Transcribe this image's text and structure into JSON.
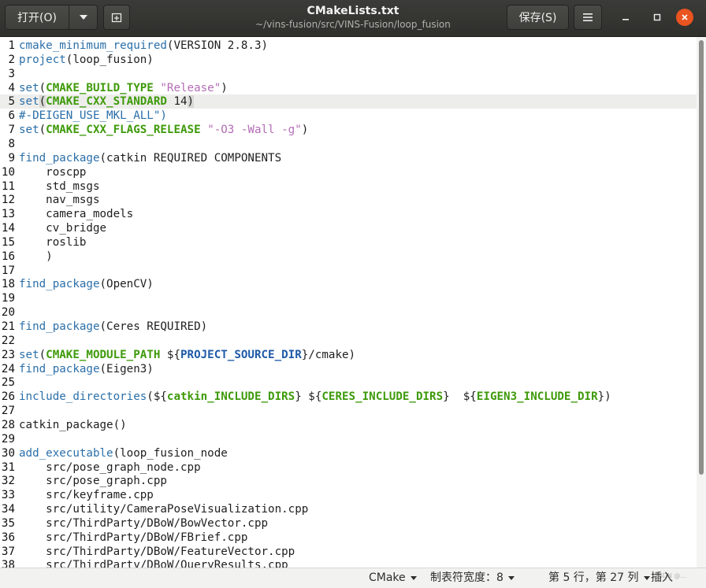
{
  "header": {
    "open_label": "打开(O)",
    "save_label": "保存(S)",
    "title": "CMakeLists.txt",
    "subtitle": "~/vins-fusion/src/VINS-Fusion/loop_fusion",
    "icons": [
      "chevron-down-icon",
      "new-document-icon",
      "hamburger-menu-icon",
      "minimize-icon",
      "maximize-icon",
      "close-icon"
    ]
  },
  "editor": {
    "current_line": 5,
    "lines": [
      {
        "n": "1",
        "t": [
          {
            "c": "fn",
            "s": "cmake_minimum_required"
          },
          {
            "c": "",
            "s": "(VERSION 2.8.3)"
          }
        ]
      },
      {
        "n": "2",
        "t": [
          {
            "c": "fn",
            "s": "project"
          },
          {
            "c": "",
            "s": "(loop_fusion)"
          }
        ]
      },
      {
        "n": "3",
        "t": []
      },
      {
        "n": "4",
        "t": [
          {
            "c": "fn",
            "s": "set"
          },
          {
            "c": "",
            "s": "("
          },
          {
            "c": "kw",
            "s": "CMAKE_BUILD_TYPE"
          },
          {
            "c": "",
            "s": " "
          },
          {
            "c": "str",
            "s": "\"Release\""
          },
          {
            "c": "",
            "s": ")"
          }
        ]
      },
      {
        "n": "5",
        "t": [
          {
            "c": "fn",
            "s": "set"
          },
          {
            "c": "bm",
            "s": "("
          },
          {
            "c": "kw",
            "s": "CMAKE_CXX_STANDARD"
          },
          {
            "c": "",
            "s": " 14"
          },
          {
            "c": "bm",
            "s": ")"
          }
        ]
      },
      {
        "n": "6",
        "t": [
          {
            "c": "cmt",
            "s": "#-DEIGEN_USE_MKL_ALL\")"
          }
        ]
      },
      {
        "n": "7",
        "t": [
          {
            "c": "fn",
            "s": "set"
          },
          {
            "c": "",
            "s": "("
          },
          {
            "c": "kw",
            "s": "CMAKE_CXX_FLAGS_RELEASE"
          },
          {
            "c": "",
            "s": " "
          },
          {
            "c": "str",
            "s": "\"-O3 -Wall -g\""
          },
          {
            "c": "",
            "s": ")"
          }
        ]
      },
      {
        "n": "8",
        "t": []
      },
      {
        "n": "9",
        "t": [
          {
            "c": "fn",
            "s": "find_package"
          },
          {
            "c": "",
            "s": "(catkin REQUIRED COMPONENTS"
          }
        ]
      },
      {
        "n": "10",
        "t": [
          {
            "c": "",
            "s": "    roscpp"
          }
        ]
      },
      {
        "n": "11",
        "t": [
          {
            "c": "",
            "s": "    std_msgs"
          }
        ]
      },
      {
        "n": "12",
        "t": [
          {
            "c": "",
            "s": "    nav_msgs"
          }
        ]
      },
      {
        "n": "13",
        "t": [
          {
            "c": "",
            "s": "    camera_models"
          }
        ]
      },
      {
        "n": "14",
        "t": [
          {
            "c": "",
            "s": "    cv_bridge"
          }
        ]
      },
      {
        "n": "15",
        "t": [
          {
            "c": "",
            "s": "    roslib"
          }
        ]
      },
      {
        "n": "16",
        "t": [
          {
            "c": "",
            "s": "    )"
          }
        ]
      },
      {
        "n": "17",
        "t": []
      },
      {
        "n": "18",
        "t": [
          {
            "c": "fn",
            "s": "find_package"
          },
          {
            "c": "",
            "s": "(OpenCV)"
          }
        ]
      },
      {
        "n": "19",
        "t": []
      },
      {
        "n": "20",
        "t": []
      },
      {
        "n": "21",
        "t": [
          {
            "c": "fn",
            "s": "find_package"
          },
          {
            "c": "",
            "s": "(Ceres REQUIRED)"
          }
        ]
      },
      {
        "n": "22",
        "t": []
      },
      {
        "n": "23",
        "t": [
          {
            "c": "fn",
            "s": "set"
          },
          {
            "c": "",
            "s": "("
          },
          {
            "c": "kw",
            "s": "CMAKE_MODULE_PATH"
          },
          {
            "c": "",
            "s": " ${"
          },
          {
            "c": "var",
            "s": "PROJECT_SOURCE_DIR"
          },
          {
            "c": "",
            "s": "}/cmake)"
          }
        ]
      },
      {
        "n": "24",
        "t": [
          {
            "c": "fn",
            "s": "find_package"
          },
          {
            "c": "",
            "s": "(Eigen3)"
          }
        ]
      },
      {
        "n": "25",
        "t": []
      },
      {
        "n": "26",
        "t": [
          {
            "c": "fn",
            "s": "include_directories"
          },
          {
            "c": "",
            "s": "(${"
          },
          {
            "c": "kw",
            "s": "catkin_INCLUDE_DIRS"
          },
          {
            "c": "",
            "s": "} ${"
          },
          {
            "c": "kw",
            "s": "CERES_INCLUDE_DIRS"
          },
          {
            "c": "",
            "s": "}  ${"
          },
          {
            "c": "kw",
            "s": "EIGEN3_INCLUDE_DIR"
          },
          {
            "c": "",
            "s": "})"
          }
        ]
      },
      {
        "n": "27",
        "t": []
      },
      {
        "n": "28",
        "t": [
          {
            "c": "",
            "s": "catkin_package()"
          }
        ]
      },
      {
        "n": "29",
        "t": []
      },
      {
        "n": "30",
        "t": [
          {
            "c": "fn",
            "s": "add_executable"
          },
          {
            "c": "",
            "s": "(loop_fusion_node"
          }
        ]
      },
      {
        "n": "31",
        "t": [
          {
            "c": "",
            "s": "    src/pose_graph_node.cpp"
          }
        ]
      },
      {
        "n": "32",
        "t": [
          {
            "c": "",
            "s": "    src/pose_graph.cpp"
          }
        ]
      },
      {
        "n": "33",
        "t": [
          {
            "c": "",
            "s": "    src/keyframe.cpp"
          }
        ]
      },
      {
        "n": "34",
        "t": [
          {
            "c": "",
            "s": "    src/utility/CameraPoseVisualization.cpp"
          }
        ]
      },
      {
        "n": "35",
        "t": [
          {
            "c": "",
            "s": "    src/ThirdParty/DBoW/BowVector.cpp"
          }
        ]
      },
      {
        "n": "36",
        "t": [
          {
            "c": "",
            "s": "    src/ThirdParty/DBoW/FBrief.cpp"
          }
        ]
      },
      {
        "n": "37",
        "t": [
          {
            "c": "",
            "s": "    src/ThirdParty/DBoW/FeatureVector.cpp"
          }
        ]
      },
      {
        "n": "38",
        "t": [
          {
            "c": "",
            "s": "    src/ThirdParty/DBoW/QueryResults.cpp"
          }
        ]
      }
    ]
  },
  "statusbar": {
    "language": "CMake",
    "tab_width": "制表符宽度：8",
    "position": "第 5 行，第 27 列",
    "insert_mode": "插入",
    "watermark": "CSDN @..."
  }
}
